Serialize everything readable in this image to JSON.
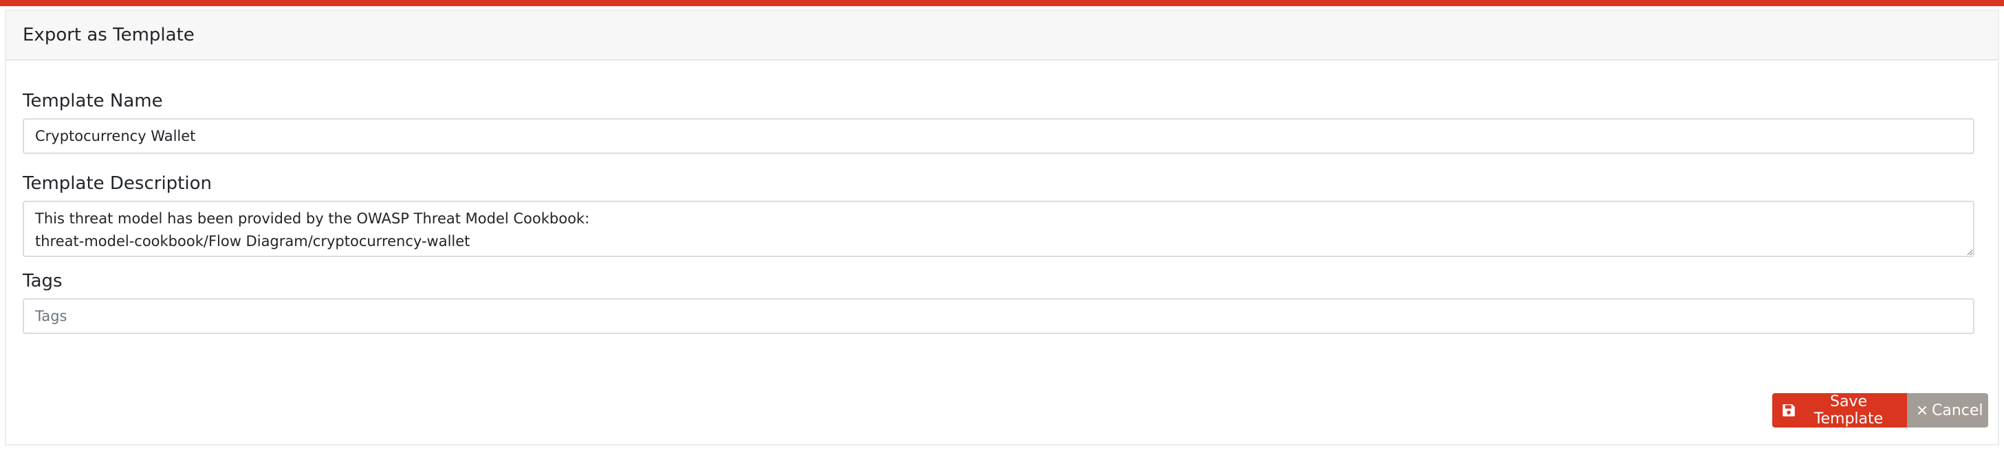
{
  "dialog": {
    "title": "Export as Template"
  },
  "form": {
    "name_label": "Template Name",
    "name_value": "Cryptocurrency Wallet",
    "description_label": "Template Description",
    "description_value": "This threat model has been provided by the OWASP Threat Model Cookbook:\nthreat-model-cookbook/Flow Diagram/cryptocurrency-wallet",
    "tags_label": "Tags",
    "tags_placeholder": "Tags",
    "tags_value": ""
  },
  "actions": {
    "save_label": "Save Template",
    "save_icon": "floppy-disk-icon",
    "cancel_label": "Cancel",
    "cancel_icon": "close-icon"
  },
  "colors": {
    "accent": "#d9351f",
    "cancel": "#a29d96"
  }
}
